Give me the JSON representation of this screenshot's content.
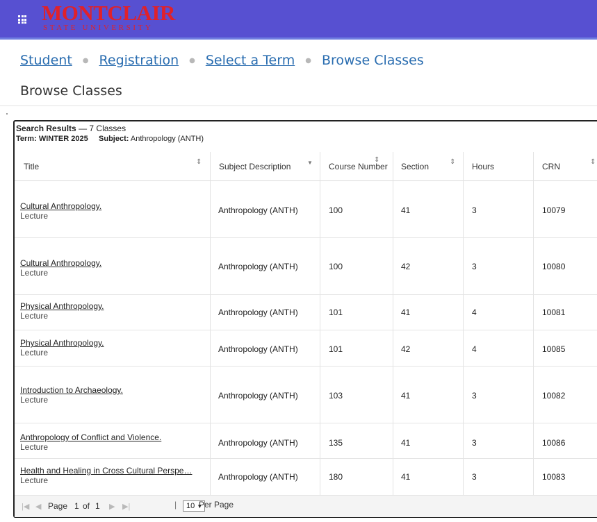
{
  "header": {
    "logo_title": "MONTCLAIR",
    "logo_subtitle": "STATE UNIVERSITY",
    "colors": {
      "bar": "#5750d1",
      "logo": "#e0212a"
    }
  },
  "breadcrumb": [
    "Student",
    "Registration",
    "Select a Term",
    "Browse Classes"
  ],
  "page_title": "Browse Classes",
  "results": {
    "heading": "Search Results",
    "count": "— 7 Classes",
    "term_label": "Term:",
    "term_value": "WINTER 2025",
    "subject_label": "Subject:",
    "subject_value": "Anthropology (ANTH)"
  },
  "table": {
    "columns": [
      "Title",
      "Subject Description",
      "Course Number",
      "Section",
      "Hours",
      "CRN"
    ],
    "rows": [
      {
        "title": "Cultural Anthropology.",
        "schedule": "Lecture",
        "subject": "Anthropology (ANTH)",
        "course": "100",
        "section": "41",
        "hours": "3",
        "crn": "10079"
      },
      {
        "title": "Cultural Anthropology.",
        "schedule": "Lecture",
        "subject": "Anthropology (ANTH)",
        "course": "100",
        "section": "42",
        "hours": "3",
        "crn": "10080"
      },
      {
        "title": "Physical Anthropology.",
        "schedule": "Lecture",
        "subject": "Anthropology (ANTH)",
        "course": "101",
        "section": "41",
        "hours": "4",
        "crn": "10081"
      },
      {
        "title": "Physical Anthropology.",
        "schedule": "Lecture",
        "subject": "Anthropology (ANTH)",
        "course": "101",
        "section": "42",
        "hours": "4",
        "crn": "10085"
      },
      {
        "title": "Introduction to Archaeology.",
        "schedule": "Lecture",
        "subject": "Anthropology (ANTH)",
        "course": "103",
        "section": "41",
        "hours": "3",
        "crn": "10082"
      },
      {
        "title": "Anthropology of Conflict and Violence.",
        "schedule": "Lecture",
        "subject": "Anthropology (ANTH)",
        "course": "135",
        "section": "41",
        "hours": "3",
        "crn": "10086"
      },
      {
        "title": "Health and Healing in Cross Cultural Perspe…",
        "schedule": "Lecture",
        "subject": "Anthropology (ANTH)",
        "course": "180",
        "section": "41",
        "hours": "3",
        "crn": "10083"
      }
    ]
  },
  "pager": {
    "page_label": "Page",
    "page_number": "1",
    "of_label": "of",
    "total_pages": "1",
    "per_page_value": "10",
    "per_page_label": "Per Page",
    "icons": [
      "first-page-icon",
      "prev-page-icon",
      "next-page-icon",
      "last-page-icon"
    ]
  }
}
